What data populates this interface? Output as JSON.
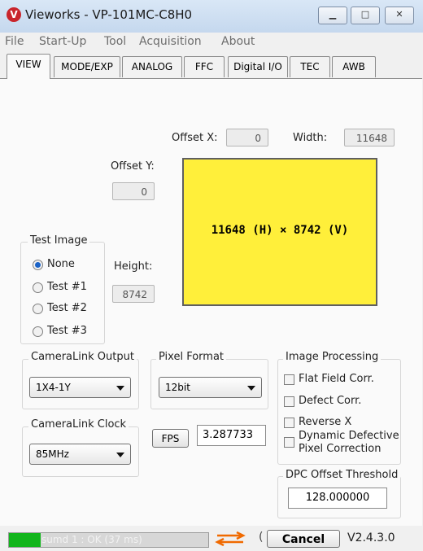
{
  "window": {
    "title": "Vieworks - VP-101MC-C8H0",
    "icon_glyph": "V",
    "controls": [
      "minimize-icon",
      "maximize-icon",
      "close-icon"
    ]
  },
  "menu": [
    "File",
    "Start-Up",
    "Tool",
    "Acquisition",
    "About"
  ],
  "tabs": [
    "VIEW",
    "MODE/EXP",
    "ANALOG",
    "FFC",
    "Digital I/O",
    "TEC",
    "AWB"
  ],
  "active_tab": "VIEW",
  "roi": {
    "offset_x_label": "Offset X:",
    "offset_x": "0",
    "width_label": "Width:",
    "width": "11648",
    "offset_y_label": "Offset Y:",
    "offset_y": "0",
    "height_label": "Height:",
    "height": "8742",
    "preview_text": "11648 (H) × 8742 (V)",
    "preview_color": "#ffef3a"
  },
  "test_image": {
    "title": "Test Image",
    "options": [
      "None",
      "Test #1",
      "Test #2",
      "Test #3"
    ],
    "selected": "None"
  },
  "cameralink_output": {
    "title": "CameraLink Output",
    "value": "1X4-1Y"
  },
  "pixel_format": {
    "title": "Pixel Format",
    "value": "12bit"
  },
  "cameralink_clock": {
    "title": "CameraLink Clock",
    "value": "85MHz"
  },
  "fps": {
    "label": "FPS",
    "value": "3.287733"
  },
  "image_processing": {
    "title": "Image Processing",
    "options": [
      "Flat Field Corr.",
      "Defect Corr.",
      "Reverse X",
      "Dynamic Defective",
      "Pixel Correction"
    ]
  },
  "dpc": {
    "title": "DPC Offset Threshold",
    "value": "128.000000"
  },
  "status": {
    "progress_text": "sumd 1 : OK (37 ms)",
    "progress_fraction": 0.16,
    "cancel_label": "Cancel",
    "version": "V2.4.3.0",
    "accent": "#f06a00"
  }
}
